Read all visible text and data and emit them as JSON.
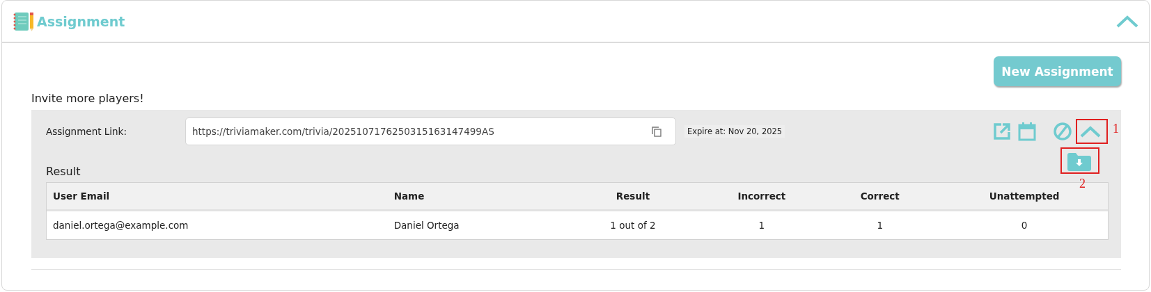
{
  "header": {
    "title": "Assignment",
    "expanded": true
  },
  "new_button": "New Assignment",
  "invite_heading": "Invite more players!",
  "link_row": {
    "label": "Assignment Link:",
    "value": "https://triviamaker.com/trivia/2025107176250315163147499AS",
    "expire": "Expire at: Nov 20, 2025",
    "expanded": true
  },
  "annotations": [
    {
      "label": "1"
    },
    {
      "label": "2"
    }
  ],
  "result_heading": "Result",
  "table": {
    "columns": [
      "User Email",
      "Name",
      "Result",
      "Incorrect",
      "Correct",
      "Unattempted"
    ],
    "rows": [
      [
        "daniel.ortega@example.com",
        "Daniel Ortega",
        "1 out of 2",
        "1",
        "1",
        "0"
      ]
    ]
  }
}
